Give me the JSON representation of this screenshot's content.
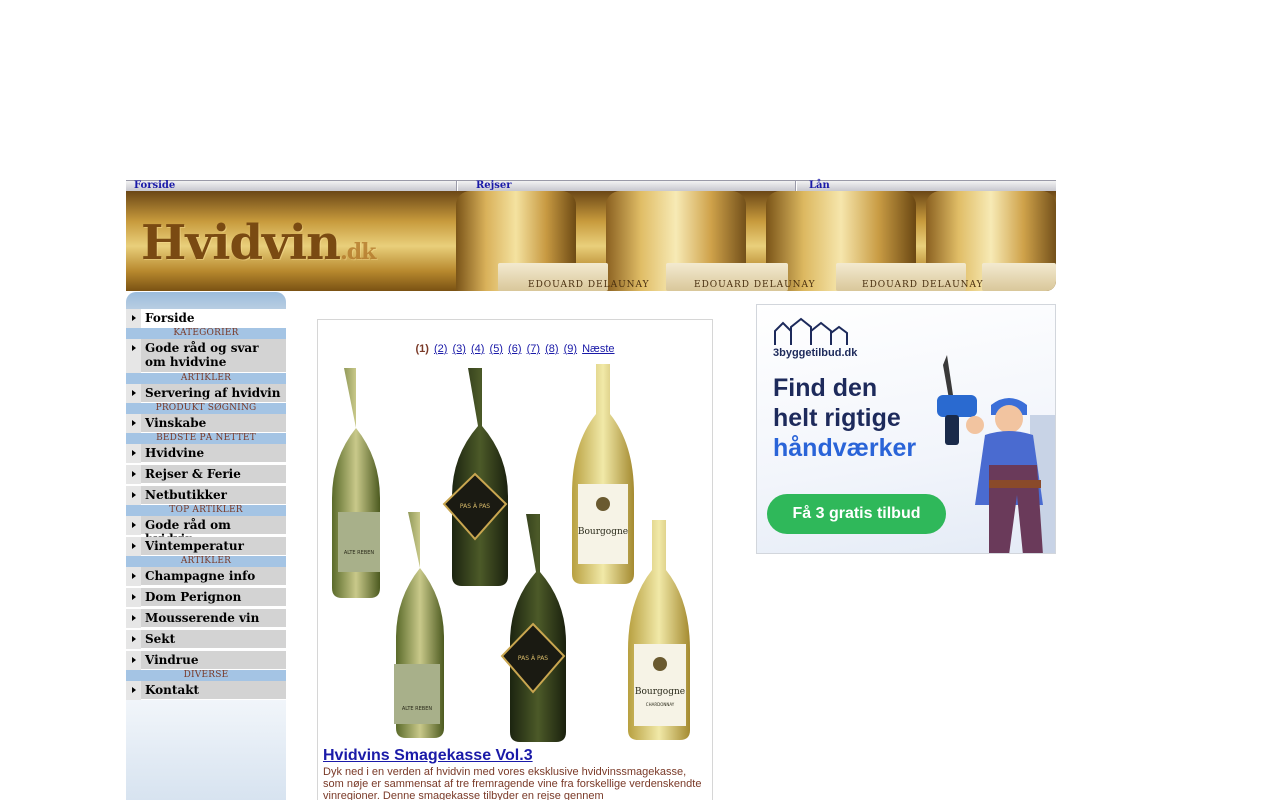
{
  "topnav": {
    "links": [
      {
        "label": "Forside"
      },
      {
        "label": "Rejser"
      },
      {
        "label": "Lån"
      }
    ]
  },
  "banner": {
    "logo_main": "Hvidvin",
    "logo_suffix": ".dk",
    "bottle_label": "EDOUARD DELAUNAY"
  },
  "sidebar": {
    "forside": "Forside",
    "cat1": "KATEGORIER",
    "item_godraad": "Gode råd og svar om hvidvine",
    "cat2": "ARTIKLER",
    "item_servering": "Servering af hvidvin",
    "cat3": "PRODUKT SØGNING",
    "item_vinskabe": "Vinskabe",
    "cat4": "BEDSTE PÅ NETTET",
    "item_hvidvine": "Hvidvine",
    "item_rejser": "Rejser & Ferie",
    "item_netbutikker": "Netbutikker",
    "cat5": "TOP ARTIKLER",
    "item_godraad2": "Gode råd om hvidvin",
    "item_vintemp": "Vintemperatur",
    "cat6": "ARTIKLER",
    "item_champagne": "Champagne info",
    "item_dom": "Dom Perignon",
    "item_mousserende": "Mousserende vin",
    "item_sekt": "Sekt",
    "item_vindrue": "Vindrue",
    "cat7": "DIVERSE",
    "item_kontakt": "Kontakt"
  },
  "product": {
    "pager": {
      "current": "(1)",
      "pages": [
        "(2)",
        "(3)",
        "(4)",
        "(5)",
        "(6)",
        "(7)",
        "(8)",
        "(9)"
      ],
      "next": "Næste"
    },
    "bottle_labels": {
      "alte": "ALTE REBEN",
      "pas": "PAS À PAS",
      "bourgogne": "Bourgogne",
      "chardonnay": "CHARDONNAY"
    },
    "title": "Hvidvins Smagekasse Vol.3",
    "description": "Dyk ned i en verden af hvidvin med vores eksklusive hvidvinssmagekasse, som nøje er sammensat af tre fremragende vine fra forskellige verdenskendte vinregioner. Denne smagekasse tilbyder en rejse gennem"
  },
  "ad": {
    "brand": "3byggetilbud.dk",
    "headline_1": "Find den",
    "headline_2": "helt rigtige",
    "headline_3": "håndværker",
    "cta": "Få 3 gratis tilbud"
  },
  "colors": {
    "link": "#1a1aa8",
    "category_text": "#7a3a28",
    "sidebar_item_bg": "#d3d3d3",
    "category_bg": "#a4c4e4",
    "ad_green": "#2fb85a",
    "ad_navy": "#1d2a5b"
  }
}
